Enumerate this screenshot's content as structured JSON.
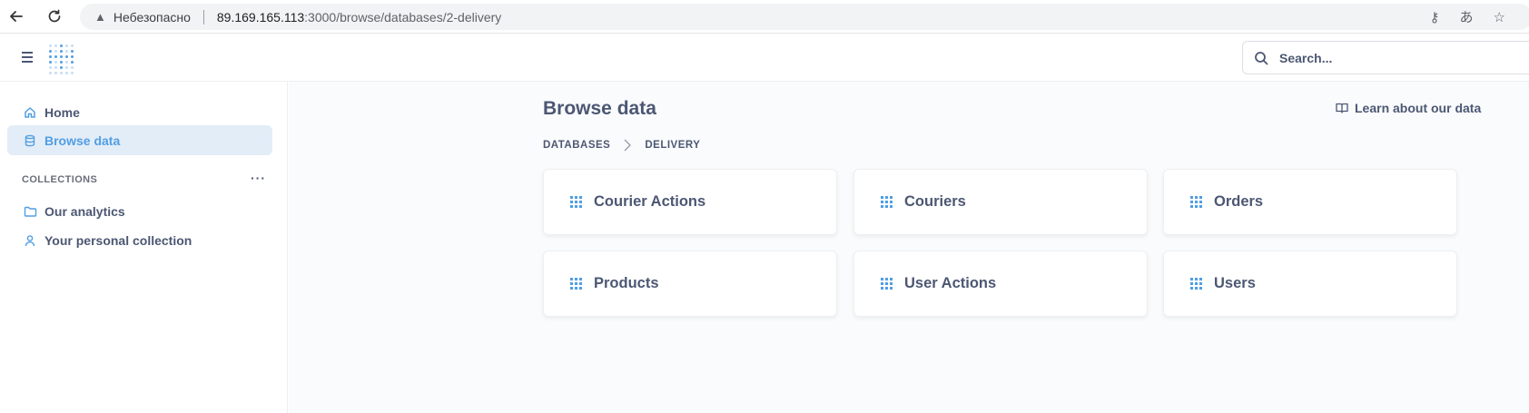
{
  "browser": {
    "security_label": "Небезопасно",
    "url_host": "89.169.165.113",
    "url_path": ":3000/browse/databases/2-delivery"
  },
  "header": {
    "search_placeholder": "Search..."
  },
  "sidebar": {
    "items": [
      {
        "label": "Home",
        "icon": "home-icon"
      },
      {
        "label": "Browse data",
        "icon": "database-icon",
        "active": true
      }
    ],
    "collections_header": "COLLECTIONS",
    "collections": [
      {
        "label": "Our analytics",
        "icon": "folder-icon"
      },
      {
        "label": "Your personal collection",
        "icon": "person-icon"
      }
    ]
  },
  "main": {
    "title": "Browse data",
    "learn_link": "Learn about our data",
    "breadcrumb": [
      "DATABASES",
      "DELIVERY"
    ],
    "tables": [
      "Courier Actions",
      "Couriers",
      "Orders",
      "Products",
      "User Actions",
      "Users"
    ]
  },
  "colors": {
    "brand": "#509ee3",
    "text": "#4c5773",
    "active_bg": "#e3edf8",
    "main_bg": "#f9fbfc"
  }
}
